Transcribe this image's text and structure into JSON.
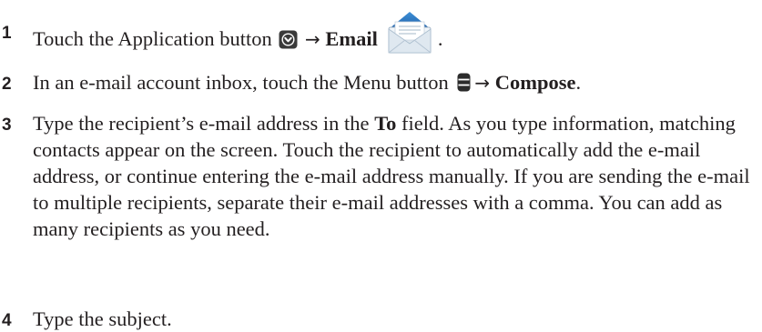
{
  "steps": [
    {
      "number": "1",
      "before": "Touch the Application button ",
      "arrow": "→",
      "emphasis": "Email",
      "after": "."
    },
    {
      "number": "2",
      "before": "In an e-mail account inbox, touch the Menu button ",
      "arrow": "→",
      "emphasis": "Compose",
      "after": "."
    },
    {
      "number": "3",
      "before": "Type the recipient’s e-mail address in the ",
      "emphasis": "To",
      "after": " field. As you type information, matching contacts appear on the screen. Touch the recipient to automatically add the e-mail address, or continue entering the e-mail address manually. If you are sending the e-mail to multiple recipients, separate their e-mail addresses with a comma. You can add as many recipients as you need."
    },
    {
      "number": "4",
      "text": "Type the subject."
    }
  ],
  "icons": {
    "application": "application-button-icon",
    "menu": "menu-button-icon",
    "email": "email-app-icon"
  }
}
